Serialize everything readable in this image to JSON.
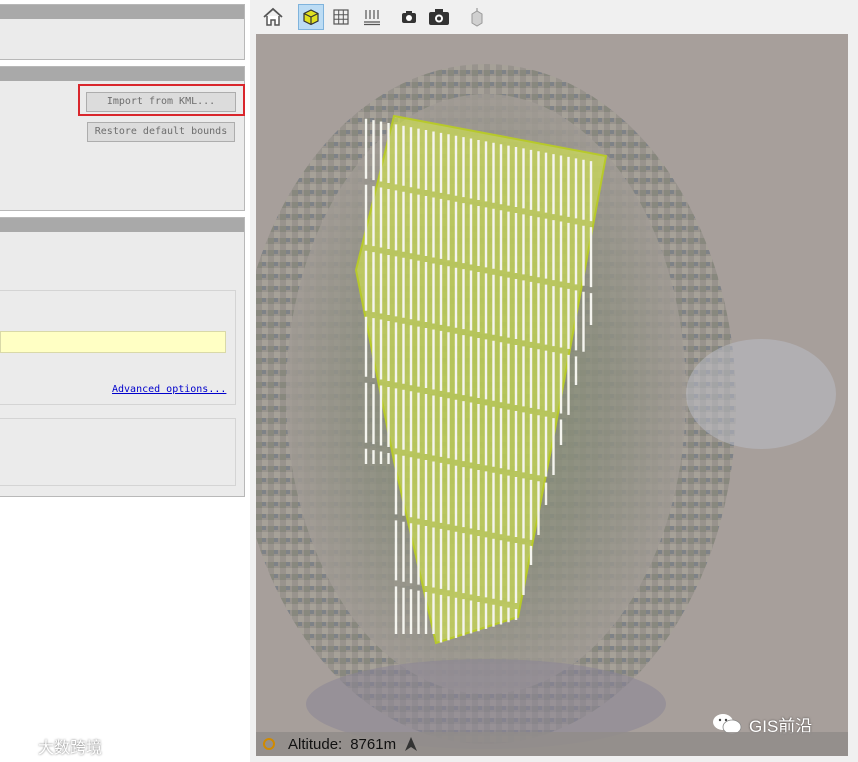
{
  "left_panel": {
    "import_button_label": "Import from KML...",
    "restore_button_label": "Restore default bounds",
    "advanced_link_label": "Advanced options...",
    "input_value": ""
  },
  "toolbar": {
    "buttons": [
      {
        "name": "home",
        "icon": "home-icon",
        "active": false
      },
      {
        "name": "3d-view",
        "icon": "cube-icon",
        "active": true
      },
      {
        "name": "grid",
        "icon": "grid-icon",
        "active": false
      },
      {
        "name": "ground-points",
        "icon": "ground-points-icon",
        "active": false
      },
      {
        "name": "small-camera",
        "icon": "camera-small-icon",
        "active": false
      },
      {
        "name": "camera",
        "icon": "camera-icon",
        "active": false
      },
      {
        "name": "dem",
        "icon": "dem-icon",
        "active": false
      }
    ]
  },
  "status": {
    "altitude_label": "Altitude:",
    "altitude_value": "8761m"
  },
  "watermarks": {
    "right": "GIS前沿",
    "left": "大数跨境"
  },
  "colors": {
    "highlight": "#d9262c",
    "polygon_fill": "#d4e64a",
    "input_bg": "#ffffc4"
  }
}
